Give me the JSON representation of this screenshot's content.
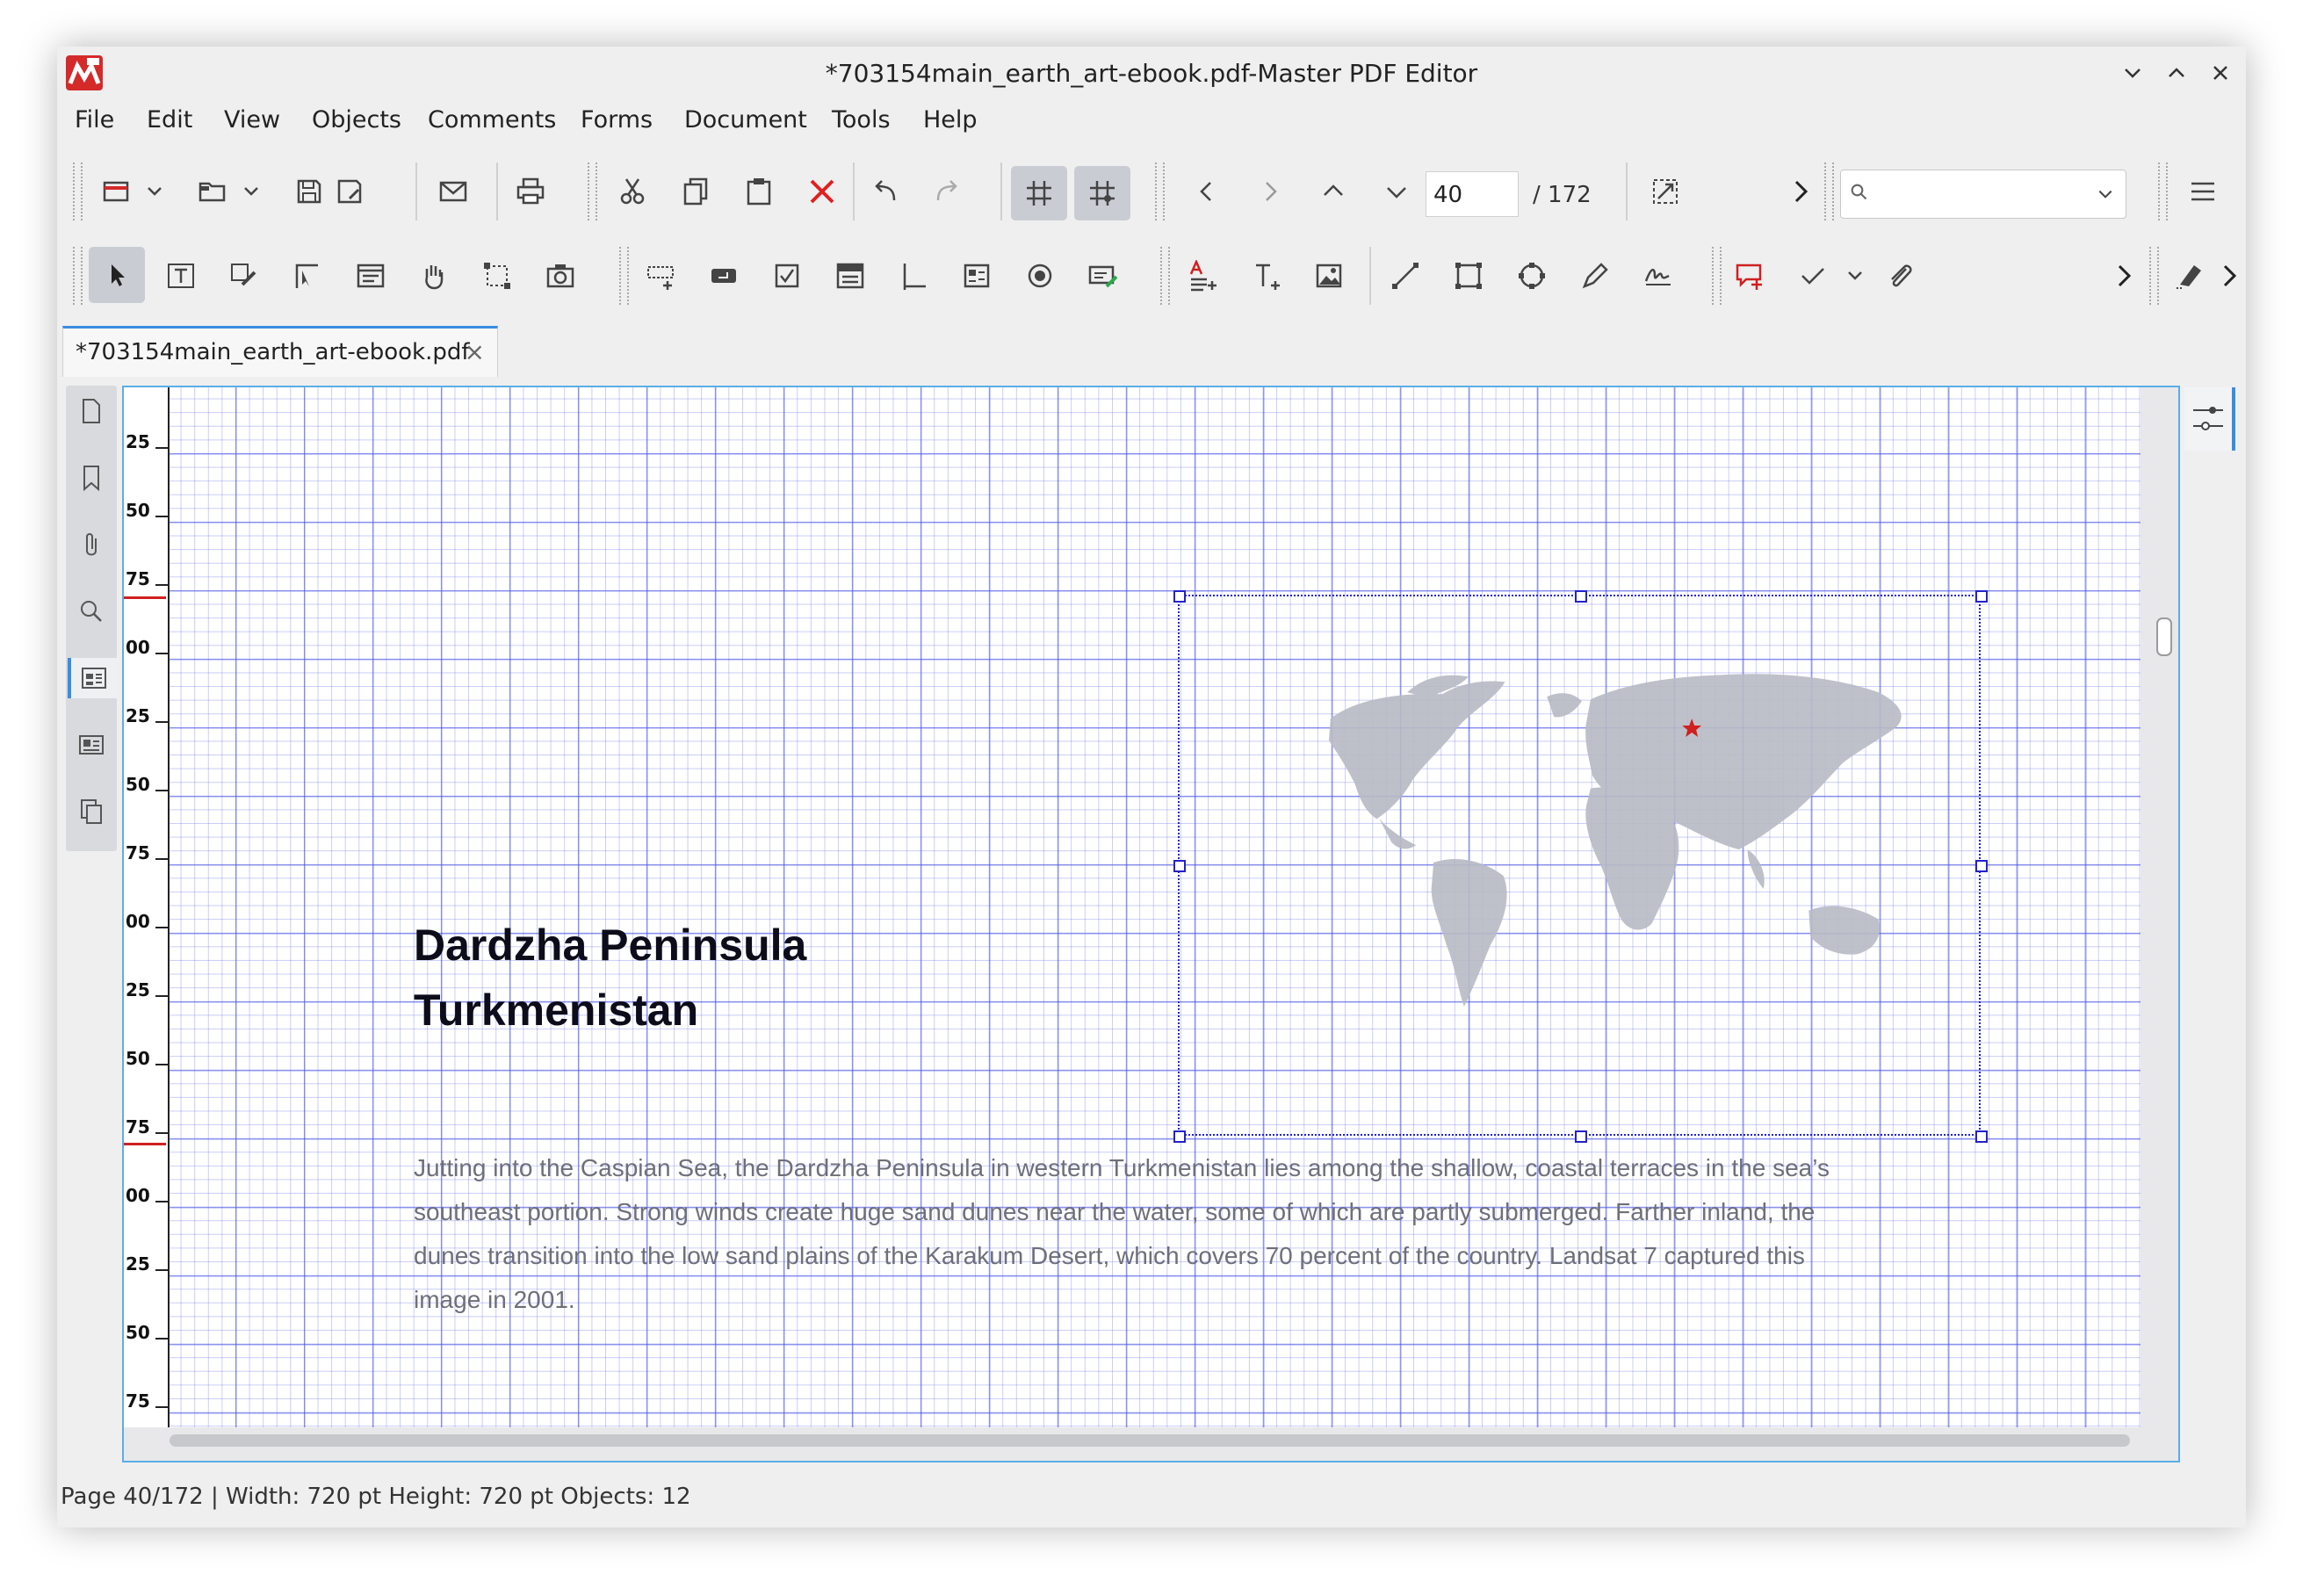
{
  "window": {
    "title": "*703154main_earth_art-ebook.pdf-Master PDF Editor"
  },
  "menu": [
    "File",
    "Edit",
    "View",
    "Objects",
    "Comments",
    "Forms",
    "Document",
    "Tools",
    "Help"
  ],
  "nav": {
    "current_page": "40",
    "total_pages": "/ 172",
    "search_placeholder": ""
  },
  "tab": {
    "label": "*703154main_earth_art-ebook.pdf",
    "close": "×"
  },
  "ruler": {
    "labels": [
      "25",
      "50",
      "75",
      "00",
      "25",
      "50",
      "75",
      "00",
      "25",
      "50",
      "75",
      "00",
      "25",
      "50",
      "75"
    ]
  },
  "document": {
    "heading_line1": "Dardzha Peninsula",
    "heading_line2": "Turkmenistan",
    "paragraph_lines": [
      "Jutting into the Caspian Sea, the Dardzha Peninsula in western Turkmenistan lies among the shallow, coastal terraces in the sea’s",
      "southeast portion. Strong winds create huge sand dunes near the water, some of which are partly submerged. Farther inland, the",
      "dunes transition into the low sand plains of the Karakum Desert, which covers 70 percent of the country. Landsat 7 captured this",
      "image in 2001."
    ]
  },
  "status": {
    "text": "Page 40/172 | Width: 720 pt Height: 720 pt Objects: 12"
  },
  "colors": {
    "accent": "#3a8ce0",
    "grid": "#4650e6",
    "selection": "#2222cc",
    "delete": "#e02020",
    "map_land": "#b8bac4",
    "marker": "#d02020"
  }
}
